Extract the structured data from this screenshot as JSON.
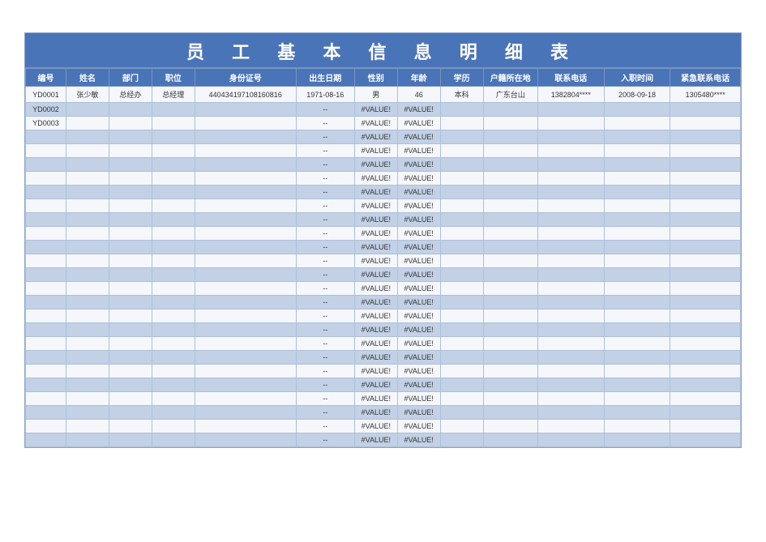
{
  "title": "员 工 基 本 信 息 明 细 表",
  "columns": [
    "编号",
    "姓名",
    "部门",
    "职位",
    "身份证号",
    "出生日期",
    "性别",
    "年龄",
    "学历",
    "户籍所在地",
    "联系电话",
    "入职时间",
    "紧急联系电话"
  ],
  "rows": [
    {
      "id": "YD0001",
      "name": "张少敏",
      "dept": "总经办",
      "pos": "总经理",
      "idno": "440434197108160816",
      "bday": "1971-08-16",
      "sex": "男",
      "age": "46",
      "edu": "本科",
      "loc": "广东台山",
      "tel": "1382804****",
      "hire": "2008-09-18",
      "etel": "1305480****"
    },
    {
      "id": "YD0002",
      "name": "",
      "dept": "",
      "pos": "",
      "idno": "",
      "bday": "--",
      "sex": "#VALUE!",
      "age": "#VALUE!",
      "edu": "",
      "loc": "",
      "tel": "",
      "hire": "",
      "etel": ""
    },
    {
      "id": "YD0003",
      "name": "",
      "dept": "",
      "pos": "",
      "idno": "",
      "bday": "--",
      "sex": "#VALUE!",
      "age": "#VALUE!",
      "edu": "",
      "loc": "",
      "tel": "",
      "hire": "",
      "etel": ""
    },
    {
      "id": "",
      "name": "",
      "dept": "",
      "pos": "",
      "idno": "",
      "bday": "--",
      "sex": "#VALUE!",
      "age": "#VALUE!",
      "edu": "",
      "loc": "",
      "tel": "",
      "hire": "",
      "etel": ""
    },
    {
      "id": "",
      "name": "",
      "dept": "",
      "pos": "",
      "idno": "",
      "bday": "--",
      "sex": "#VALUE!",
      "age": "#VALUE!",
      "edu": "",
      "loc": "",
      "tel": "",
      "hire": "",
      "etel": ""
    },
    {
      "id": "",
      "name": "",
      "dept": "",
      "pos": "",
      "idno": "",
      "bday": "--",
      "sex": "#VALUE!",
      "age": "#VALUE!",
      "edu": "",
      "loc": "",
      "tel": "",
      "hire": "",
      "etel": ""
    },
    {
      "id": "",
      "name": "",
      "dept": "",
      "pos": "",
      "idno": "",
      "bday": "--",
      "sex": "#VALUE!",
      "age": "#VALUE!",
      "edu": "",
      "loc": "",
      "tel": "",
      "hire": "",
      "etel": ""
    },
    {
      "id": "",
      "name": "",
      "dept": "",
      "pos": "",
      "idno": "",
      "bday": "--",
      "sex": "#VALUE!",
      "age": "#VALUE!",
      "edu": "",
      "loc": "",
      "tel": "",
      "hire": "",
      "etel": ""
    },
    {
      "id": "",
      "name": "",
      "dept": "",
      "pos": "",
      "idno": "",
      "bday": "--",
      "sex": "#VALUE!",
      "age": "#VALUE!",
      "edu": "",
      "loc": "",
      "tel": "",
      "hire": "",
      "etel": ""
    },
    {
      "id": "",
      "name": "",
      "dept": "",
      "pos": "",
      "idno": "",
      "bday": "--",
      "sex": "#VALUE!",
      "age": "#VALUE!",
      "edu": "",
      "loc": "",
      "tel": "",
      "hire": "",
      "etel": ""
    },
    {
      "id": "",
      "name": "",
      "dept": "",
      "pos": "",
      "idno": "",
      "bday": "--",
      "sex": "#VALUE!",
      "age": "#VALUE!",
      "edu": "",
      "loc": "",
      "tel": "",
      "hire": "",
      "etel": ""
    },
    {
      "id": "",
      "name": "",
      "dept": "",
      "pos": "",
      "idno": "",
      "bday": "--",
      "sex": "#VALUE!",
      "age": "#VALUE!",
      "edu": "",
      "loc": "",
      "tel": "",
      "hire": "",
      "etel": ""
    },
    {
      "id": "",
      "name": "",
      "dept": "",
      "pos": "",
      "idno": "",
      "bday": "--",
      "sex": "#VALUE!",
      "age": "#VALUE!",
      "edu": "",
      "loc": "",
      "tel": "",
      "hire": "",
      "etel": ""
    },
    {
      "id": "",
      "name": "",
      "dept": "",
      "pos": "",
      "idno": "",
      "bday": "--",
      "sex": "#VALUE!",
      "age": "#VALUE!",
      "edu": "",
      "loc": "",
      "tel": "",
      "hire": "",
      "etel": ""
    },
    {
      "id": "",
      "name": "",
      "dept": "",
      "pos": "",
      "idno": "",
      "bday": "--",
      "sex": "#VALUE!",
      "age": "#VALUE!",
      "edu": "",
      "loc": "",
      "tel": "",
      "hire": "",
      "etel": ""
    },
    {
      "id": "",
      "name": "",
      "dept": "",
      "pos": "",
      "idno": "",
      "bday": "--",
      "sex": "#VALUE!",
      "age": "#VALUE!",
      "edu": "",
      "loc": "",
      "tel": "",
      "hire": "",
      "etel": ""
    },
    {
      "id": "",
      "name": "",
      "dept": "",
      "pos": "",
      "idno": "",
      "bday": "--",
      "sex": "#VALUE!",
      "age": "#VALUE!",
      "edu": "",
      "loc": "",
      "tel": "",
      "hire": "",
      "etel": ""
    },
    {
      "id": "",
      "name": "",
      "dept": "",
      "pos": "",
      "idno": "",
      "bday": "--",
      "sex": "#VALUE!",
      "age": "#VALUE!",
      "edu": "",
      "loc": "",
      "tel": "",
      "hire": "",
      "etel": ""
    },
    {
      "id": "",
      "name": "",
      "dept": "",
      "pos": "",
      "idno": "",
      "bday": "--",
      "sex": "#VALUE!",
      "age": "#VALUE!",
      "edu": "",
      "loc": "",
      "tel": "",
      "hire": "",
      "etel": ""
    },
    {
      "id": "",
      "name": "",
      "dept": "",
      "pos": "",
      "idno": "",
      "bday": "--",
      "sex": "#VALUE!",
      "age": "#VALUE!",
      "edu": "",
      "loc": "",
      "tel": "",
      "hire": "",
      "etel": ""
    },
    {
      "id": "",
      "name": "",
      "dept": "",
      "pos": "",
      "idno": "",
      "bday": "--",
      "sex": "#VALUE!",
      "age": "#VALUE!",
      "edu": "",
      "loc": "",
      "tel": "",
      "hire": "",
      "etel": ""
    },
    {
      "id": "",
      "name": "",
      "dept": "",
      "pos": "",
      "idno": "",
      "bday": "--",
      "sex": "#VALUE!",
      "age": "#VALUE!",
      "edu": "",
      "loc": "",
      "tel": "",
      "hire": "",
      "etel": ""
    },
    {
      "id": "",
      "name": "",
      "dept": "",
      "pos": "",
      "idno": "",
      "bday": "--",
      "sex": "#VALUE!",
      "age": "#VALUE!",
      "edu": "",
      "loc": "",
      "tel": "",
      "hire": "",
      "etel": ""
    },
    {
      "id": "",
      "name": "",
      "dept": "",
      "pos": "",
      "idno": "",
      "bday": "--",
      "sex": "#VALUE!",
      "age": "#VALUE!",
      "edu": "",
      "loc": "",
      "tel": "",
      "hire": "",
      "etel": ""
    },
    {
      "id": "",
      "name": "",
      "dept": "",
      "pos": "",
      "idno": "",
      "bday": "--",
      "sex": "#VALUE!",
      "age": "#VALUE!",
      "edu": "",
      "loc": "",
      "tel": "",
      "hire": "",
      "etel": ""
    },
    {
      "id": "",
      "name": "",
      "dept": "",
      "pos": "",
      "idno": "",
      "bday": "--",
      "sex": "#VALUE!",
      "age": "#VALUE!",
      "edu": "",
      "loc": "",
      "tel": "",
      "hire": "",
      "etel": ""
    }
  ]
}
